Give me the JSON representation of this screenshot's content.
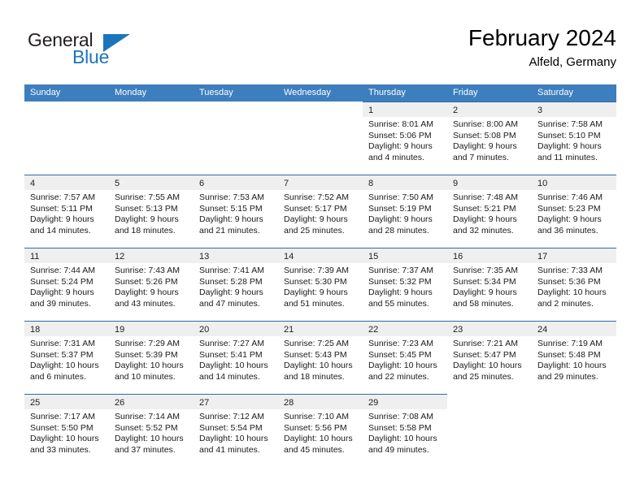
{
  "brand": {
    "name_part1": "General",
    "name_part2": "Blue"
  },
  "header": {
    "title": "February 2024",
    "subtitle": "Alfeld, Germany"
  },
  "colors": {
    "header_blue": "#3d7ebe",
    "cell_top_border": "#2d6ca8",
    "daynum_band": "#efefef",
    "brand_blue": "#1b75bb"
  },
  "weekdays": [
    "Sunday",
    "Monday",
    "Tuesday",
    "Wednesday",
    "Thursday",
    "Friday",
    "Saturday"
  ],
  "weeks": [
    [
      {
        "empty": true
      },
      {
        "empty": true
      },
      {
        "empty": true
      },
      {
        "empty": true
      },
      {
        "day": "1",
        "sunrise": "Sunrise: 8:01 AM",
        "sunset": "Sunset: 5:06 PM",
        "daylight1": "Daylight: 9 hours",
        "daylight2": "and 4 minutes."
      },
      {
        "day": "2",
        "sunrise": "Sunrise: 8:00 AM",
        "sunset": "Sunset: 5:08 PM",
        "daylight1": "Daylight: 9 hours",
        "daylight2": "and 7 minutes."
      },
      {
        "day": "3",
        "sunrise": "Sunrise: 7:58 AM",
        "sunset": "Sunset: 5:10 PM",
        "daylight1": "Daylight: 9 hours",
        "daylight2": "and 11 minutes."
      }
    ],
    [
      {
        "day": "4",
        "sunrise": "Sunrise: 7:57 AM",
        "sunset": "Sunset: 5:11 PM",
        "daylight1": "Daylight: 9 hours",
        "daylight2": "and 14 minutes."
      },
      {
        "day": "5",
        "sunrise": "Sunrise: 7:55 AM",
        "sunset": "Sunset: 5:13 PM",
        "daylight1": "Daylight: 9 hours",
        "daylight2": "and 18 minutes."
      },
      {
        "day": "6",
        "sunrise": "Sunrise: 7:53 AM",
        "sunset": "Sunset: 5:15 PM",
        "daylight1": "Daylight: 9 hours",
        "daylight2": "and 21 minutes."
      },
      {
        "day": "7",
        "sunrise": "Sunrise: 7:52 AM",
        "sunset": "Sunset: 5:17 PM",
        "daylight1": "Daylight: 9 hours",
        "daylight2": "and 25 minutes."
      },
      {
        "day": "8",
        "sunrise": "Sunrise: 7:50 AM",
        "sunset": "Sunset: 5:19 PM",
        "daylight1": "Daylight: 9 hours",
        "daylight2": "and 28 minutes."
      },
      {
        "day": "9",
        "sunrise": "Sunrise: 7:48 AM",
        "sunset": "Sunset: 5:21 PM",
        "daylight1": "Daylight: 9 hours",
        "daylight2": "and 32 minutes."
      },
      {
        "day": "10",
        "sunrise": "Sunrise: 7:46 AM",
        "sunset": "Sunset: 5:23 PM",
        "daylight1": "Daylight: 9 hours",
        "daylight2": "and 36 minutes."
      }
    ],
    [
      {
        "day": "11",
        "sunrise": "Sunrise: 7:44 AM",
        "sunset": "Sunset: 5:24 PM",
        "daylight1": "Daylight: 9 hours",
        "daylight2": "and 39 minutes."
      },
      {
        "day": "12",
        "sunrise": "Sunrise: 7:43 AM",
        "sunset": "Sunset: 5:26 PM",
        "daylight1": "Daylight: 9 hours",
        "daylight2": "and 43 minutes."
      },
      {
        "day": "13",
        "sunrise": "Sunrise: 7:41 AM",
        "sunset": "Sunset: 5:28 PM",
        "daylight1": "Daylight: 9 hours",
        "daylight2": "and 47 minutes."
      },
      {
        "day": "14",
        "sunrise": "Sunrise: 7:39 AM",
        "sunset": "Sunset: 5:30 PM",
        "daylight1": "Daylight: 9 hours",
        "daylight2": "and 51 minutes."
      },
      {
        "day": "15",
        "sunrise": "Sunrise: 7:37 AM",
        "sunset": "Sunset: 5:32 PM",
        "daylight1": "Daylight: 9 hours",
        "daylight2": "and 55 minutes."
      },
      {
        "day": "16",
        "sunrise": "Sunrise: 7:35 AM",
        "sunset": "Sunset: 5:34 PM",
        "daylight1": "Daylight: 9 hours",
        "daylight2": "and 58 minutes."
      },
      {
        "day": "17",
        "sunrise": "Sunrise: 7:33 AM",
        "sunset": "Sunset: 5:36 PM",
        "daylight1": "Daylight: 10 hours",
        "daylight2": "and 2 minutes."
      }
    ],
    [
      {
        "day": "18",
        "sunrise": "Sunrise: 7:31 AM",
        "sunset": "Sunset: 5:37 PM",
        "daylight1": "Daylight: 10 hours",
        "daylight2": "and 6 minutes."
      },
      {
        "day": "19",
        "sunrise": "Sunrise: 7:29 AM",
        "sunset": "Sunset: 5:39 PM",
        "daylight1": "Daylight: 10 hours",
        "daylight2": "and 10 minutes."
      },
      {
        "day": "20",
        "sunrise": "Sunrise: 7:27 AM",
        "sunset": "Sunset: 5:41 PM",
        "daylight1": "Daylight: 10 hours",
        "daylight2": "and 14 minutes."
      },
      {
        "day": "21",
        "sunrise": "Sunrise: 7:25 AM",
        "sunset": "Sunset: 5:43 PM",
        "daylight1": "Daylight: 10 hours",
        "daylight2": "and 18 minutes."
      },
      {
        "day": "22",
        "sunrise": "Sunrise: 7:23 AM",
        "sunset": "Sunset: 5:45 PM",
        "daylight1": "Daylight: 10 hours",
        "daylight2": "and 22 minutes."
      },
      {
        "day": "23",
        "sunrise": "Sunrise: 7:21 AM",
        "sunset": "Sunset: 5:47 PM",
        "daylight1": "Daylight: 10 hours",
        "daylight2": "and 25 minutes."
      },
      {
        "day": "24",
        "sunrise": "Sunrise: 7:19 AM",
        "sunset": "Sunset: 5:48 PM",
        "daylight1": "Daylight: 10 hours",
        "daylight2": "and 29 minutes."
      }
    ],
    [
      {
        "day": "25",
        "sunrise": "Sunrise: 7:17 AM",
        "sunset": "Sunset: 5:50 PM",
        "daylight1": "Daylight: 10 hours",
        "daylight2": "and 33 minutes."
      },
      {
        "day": "26",
        "sunrise": "Sunrise: 7:14 AM",
        "sunset": "Sunset: 5:52 PM",
        "daylight1": "Daylight: 10 hours",
        "daylight2": "and 37 minutes."
      },
      {
        "day": "27",
        "sunrise": "Sunrise: 7:12 AM",
        "sunset": "Sunset: 5:54 PM",
        "daylight1": "Daylight: 10 hours",
        "daylight2": "and 41 minutes."
      },
      {
        "day": "28",
        "sunrise": "Sunrise: 7:10 AM",
        "sunset": "Sunset: 5:56 PM",
        "daylight1": "Daylight: 10 hours",
        "daylight2": "and 45 minutes."
      },
      {
        "day": "29",
        "sunrise": "Sunrise: 7:08 AM",
        "sunset": "Sunset: 5:58 PM",
        "daylight1": "Daylight: 10 hours",
        "daylight2": "and 49 minutes."
      },
      {
        "empty": true
      },
      {
        "empty": true
      }
    ]
  ]
}
